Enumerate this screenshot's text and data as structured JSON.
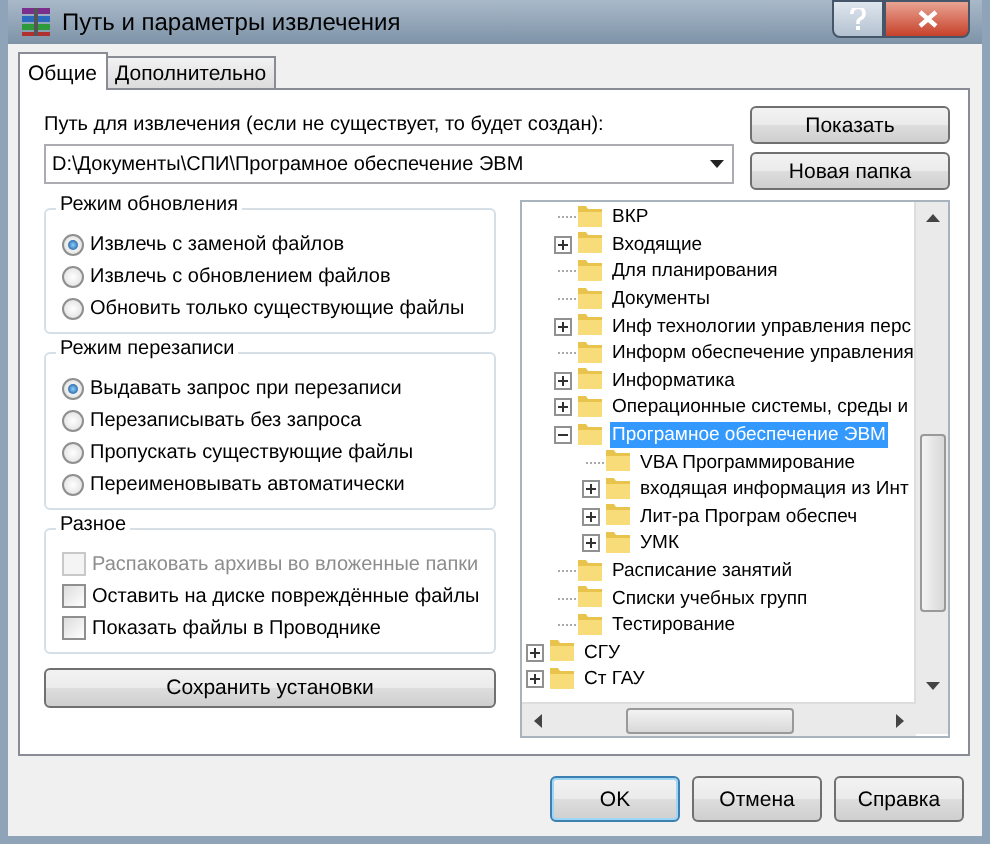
{
  "window": {
    "title": "Путь и параметры извлечения"
  },
  "tabs": [
    {
      "label": "Общие",
      "selected": true
    },
    {
      "label": "Дополнительно",
      "selected": false
    }
  ],
  "path": {
    "label": "Путь для извлечения (если не существует, то будет создан):",
    "value": "D:\\Документы\\СПИ\\Програмное обеспечение ЭВМ"
  },
  "side_buttons": [
    "Показать",
    "Новая папка"
  ],
  "update_mode": {
    "title": "Режим обновления",
    "options": [
      {
        "label": "Извлечь с заменой файлов",
        "selected": true
      },
      {
        "label": "Извлечь с обновлением файлов",
        "selected": false
      },
      {
        "label": "Обновить только существующие файлы",
        "selected": false
      }
    ]
  },
  "overwrite_mode": {
    "title": "Режим перезаписи",
    "options": [
      {
        "label": "Выдавать запрос при перезаписи",
        "selected": true
      },
      {
        "label": "Перезаписывать без запроса",
        "selected": false
      },
      {
        "label": "Пропускать существующие файлы",
        "selected": false
      },
      {
        "label": "Переименовывать автоматически",
        "selected": false
      }
    ]
  },
  "misc": {
    "title": "Разное",
    "options": [
      {
        "label": "Распаковать архивы во вложенные папки",
        "checked": false,
        "disabled": true
      },
      {
        "label": "Оставить на диске повреждённые файлы",
        "checked": false,
        "disabled": false
      },
      {
        "label": "Показать файлы в Проводнике",
        "checked": false,
        "disabled": false
      }
    ]
  },
  "save_button": "Сохранить установки",
  "tree": {
    "nodes": [
      {
        "children": [
          {
            "label": "ВКР",
            "selected": false
          },
          {
            "label": "Входящие",
            "expanded": false,
            "selected": false
          },
          {
            "label": "Для  планирования",
            "selected": false
          },
          {
            "label": "Документы",
            "selected": false
          },
          {
            "label": "Инф технологии управления перс",
            "expanded": false,
            "selected": false
          },
          {
            "label": "Информ обеспечение управления",
            "selected": false
          },
          {
            "label": "Информатика",
            "expanded": false,
            "selected": false
          },
          {
            "label": "Операционные системы, среды и",
            "expanded": false,
            "selected": false
          },
          {
            "label": "Програмное обеспечение ЭВМ",
            "expanded": true,
            "selected": true,
            "children": [
              {
                "label": "VBA Программирование",
                "selected": false
              },
              {
                "label": "входящая информация из Инт",
                "expanded": false,
                "selected": false
              },
              {
                "label": "Лит-ра Програм обеспеч",
                "expanded": false,
                "selected": false
              },
              {
                "label": "УМК",
                "expanded": false,
                "selected": false
              }
            ]
          },
          {
            "label": "Расписание занятий",
            "selected": false
          },
          {
            "label": "Списки учебных групп",
            "selected": false
          },
          {
            "label": "Тестирование",
            "selected": false
          }
        ]
      },
      {
        "label": "СГУ",
        "expanded": false,
        "selected": false
      },
      {
        "label": "Ст ГАУ",
        "expanded": false,
        "selected": false
      }
    ]
  },
  "footer_buttons": [
    "OK",
    "Отмена",
    "Справка"
  ]
}
